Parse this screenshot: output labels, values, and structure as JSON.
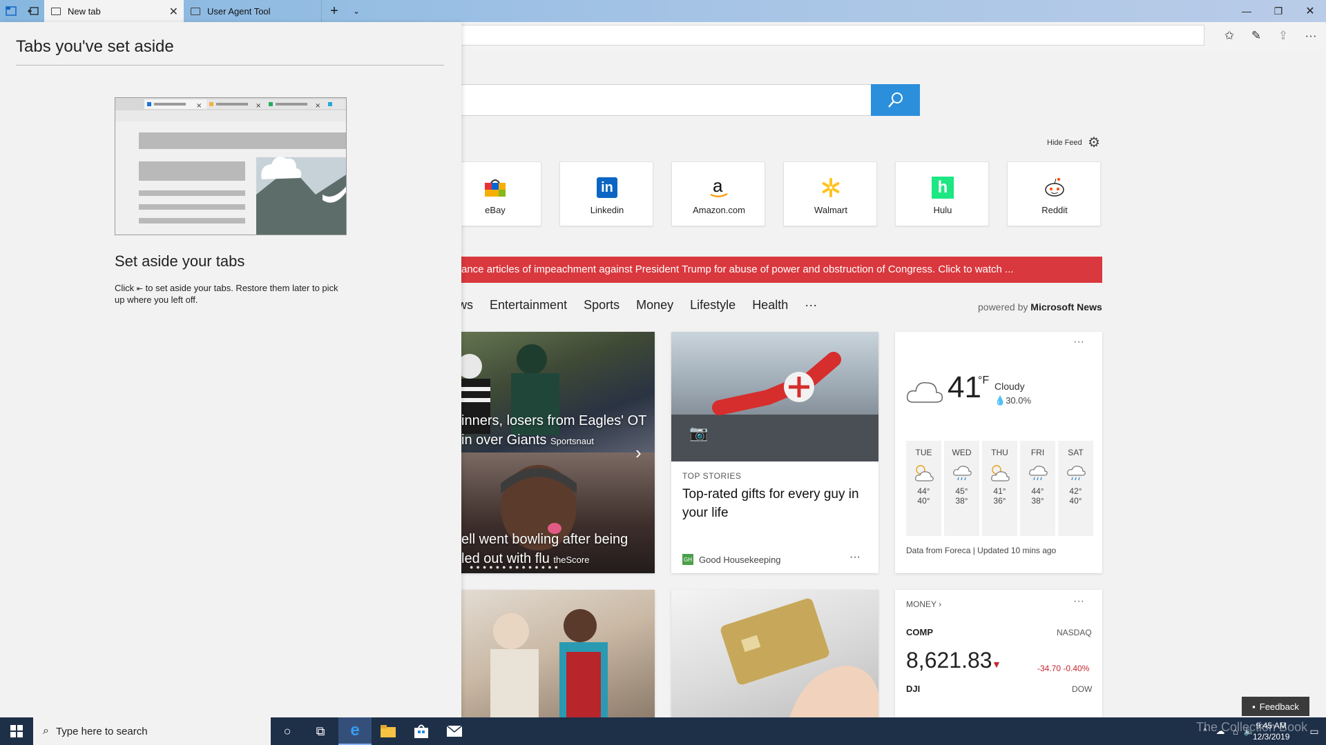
{
  "tabs": [
    {
      "label": "New tab",
      "active": true
    },
    {
      "label": "User Agent Tool",
      "active": false
    }
  ],
  "aside": {
    "title": "Tabs you've set aside",
    "heading": "Set aside your tabs",
    "desc_pre": "Click",
    "desc_post": "to set aside your tabs. Restore them later to pick up where you left off."
  },
  "feed": {
    "hide_feed": "Hide Feed",
    "tiles": [
      "eBay",
      "Linkedin",
      "Amazon.com",
      "Walmart",
      "Hulu",
      "Reddit"
    ],
    "breaking": "ance articles of impeachment against President Trump for abuse of power and obstruction of Congress. Click to watch ...",
    "nav": [
      "News",
      "Entertainment",
      "Sports",
      "Money",
      "Lifestyle",
      "Health",
      "···"
    ],
    "powered_pre": "powered by",
    "powered_brand": "Microsoft News"
  },
  "cards": {
    "slide1_line1": "inners, losers from Eagles' OT",
    "slide1_line2": "in over Giants",
    "slide1_src": "Sportsnaut",
    "slide2_line1": "ell went bowling after being",
    "slide2_line2": "led out with flu",
    "slide2_src": "theScore",
    "top_stories_tag": "TOP STORIES",
    "top_stories_title": "Top-rated gifts for every guy in your life",
    "top_stories_src": "Good Housekeeping",
    "top_stories_src_badge": "GH"
  },
  "weather": {
    "temp": "41",
    "unit": "°F",
    "condition": "Cloudy",
    "precip": "30.0%",
    "days": [
      {
        "day": "TUE",
        "hi": "44°",
        "lo": "40°",
        "icon": "partly-sunny-icon"
      },
      {
        "day": "WED",
        "hi": "45°",
        "lo": "38°",
        "icon": "rain-icon"
      },
      {
        "day": "THU",
        "hi": "41°",
        "lo": "36°",
        "icon": "partly-sunny-icon"
      },
      {
        "day": "FRI",
        "hi": "44°",
        "lo": "38°",
        "icon": "rain-icon"
      },
      {
        "day": "SAT",
        "hi": "42°",
        "lo": "40°",
        "icon": "rain-icon"
      }
    ],
    "footer": "Data from Foreca | Updated 10 mins ago"
  },
  "money": {
    "tag": "MONEY",
    "symbol": "COMP",
    "exchange": "NASDAQ",
    "value": "8,621.83",
    "change": "-34.70",
    "change_pct": "-0.40%",
    "symbol2": "DJI",
    "exchange2": "DOW"
  },
  "taskbar": {
    "search_placeholder": "Type here to search",
    "time": "9:45 AM",
    "date": "12/3/2019",
    "feedback": "Feedback",
    "watermark": "The Collection Book"
  },
  "colors": {
    "accent": "#2b8fdc",
    "breaking": "#d9383e",
    "down": "#c4262e",
    "taskbar": "#1e2f48"
  }
}
